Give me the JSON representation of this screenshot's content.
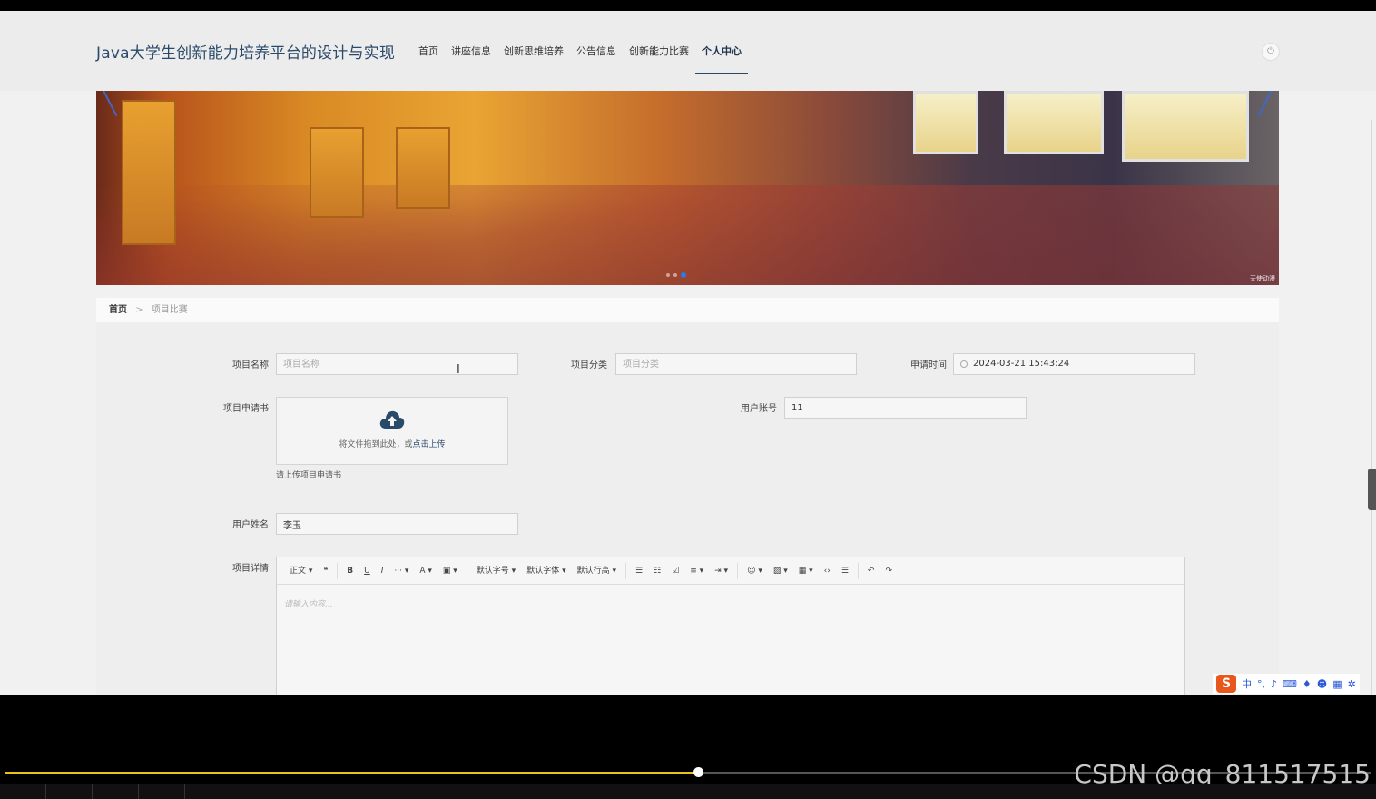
{
  "header": {
    "site_title": "Java大学生创新能力培养平台的设计与实现",
    "nav": [
      {
        "label": "首页",
        "active": false
      },
      {
        "label": "讲座信息",
        "active": false
      },
      {
        "label": "创新思维培养",
        "active": false
      },
      {
        "label": "公告信息",
        "active": false
      },
      {
        "label": "创新能力比赛",
        "active": false
      },
      {
        "label": "个人中心",
        "active": true
      }
    ],
    "power_icon": "power-icon"
  },
  "banner": {
    "watermark": "天使动漫",
    "slides": 3,
    "active_slide": 3
  },
  "breadcrumb": {
    "home": "首页",
    "separator": ">",
    "current": "项目比赛"
  },
  "form": {
    "project_name": {
      "label": "项目名称",
      "placeholder": "项目名称",
      "value": ""
    },
    "project_category": {
      "label": "项目分类",
      "placeholder": "项目分类",
      "value": ""
    },
    "apply_time": {
      "label": "申请时间",
      "value": "2024-03-21 15:43:24"
    },
    "application_file": {
      "label": "项目申请书",
      "drop_text": "将文件拖到此处，或",
      "click_text": "点击上传",
      "tip": "请上传项目申请书"
    },
    "user_account": {
      "label": "用户账号",
      "value": "11"
    },
    "user_name": {
      "label": "用户姓名",
      "value": "李玉"
    },
    "project_detail": {
      "label": "项目详情",
      "placeholder": "请输入内容...",
      "toolbar": {
        "paragraph": "正文",
        "font_size": "默认字号",
        "font_family": "默认字体",
        "line_height": "默认行高"
      }
    }
  },
  "player": {
    "progress": 0.507,
    "watermark": "CSDN @qq_811517515"
  },
  "ime": {
    "logo": "S",
    "mode": "中"
  },
  "colors": {
    "title": "#2a4a6a",
    "progress": "#e8c418"
  }
}
